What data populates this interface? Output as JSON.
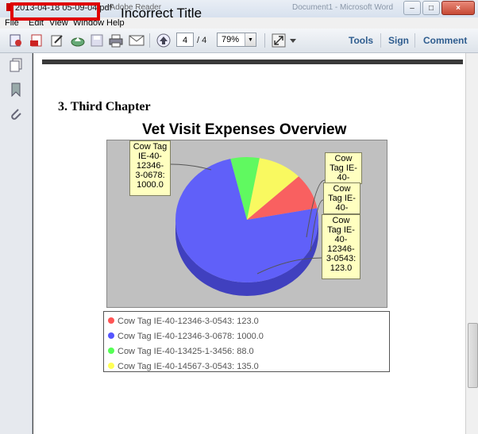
{
  "window": {
    "title_file": "2013-04-18 05-09-04.pdf",
    "title_app": "- Adobe Reader",
    "ghost_title": "Document1 - Microsoft Word",
    "controls": [
      "–",
      "□",
      "×"
    ]
  },
  "annotation": {
    "text": "Incorrect Title",
    "color": "#e00000"
  },
  "menu": {
    "items": [
      "File",
      "Edit",
      "View",
      "Window",
      "Help"
    ]
  },
  "toolbar": {
    "page_current": "4",
    "page_total": "/ 4",
    "zoom": "79%",
    "links": [
      "Tools",
      "Sign",
      "Comment"
    ]
  },
  "document": {
    "heading": "3. Third Chapter"
  },
  "chart_data": {
    "type": "pie",
    "title": "Vet Visit Expenses Overview",
    "slices": [
      {
        "name": "Cow Tag IE-40-12346-3-0543",
        "value": 123.0,
        "color": "#ff5555"
      },
      {
        "name": "Cow Tag IE-40-12346-3-0678",
        "value": 1000.0,
        "color": "#5555ff"
      },
      {
        "name": "Cow Tag IE-40-13425-1-3456",
        "value": 88.0,
        "color": "#55ff55"
      },
      {
        "name": "Cow Tag IE-40-14567-3-0543",
        "value": 135.0,
        "color": "#ffff55"
      }
    ],
    "labels": [
      "Cow Tag IE-40-12346-3-0678: 1000.0",
      "Cow Tag IE-40-",
      "Cow Tag IE-40-",
      "Cow Tag IE-40-12346-3-0543: 123.0"
    ],
    "legend": [
      "Cow Tag IE-40-12346-3-0543: 123.0",
      "Cow Tag IE-40-12346-3-0678: 1000.0",
      "Cow Tag IE-40-13425-1-3456: 88.0",
      "Cow Tag IE-40-14567-3-0543: 135.0"
    ]
  }
}
